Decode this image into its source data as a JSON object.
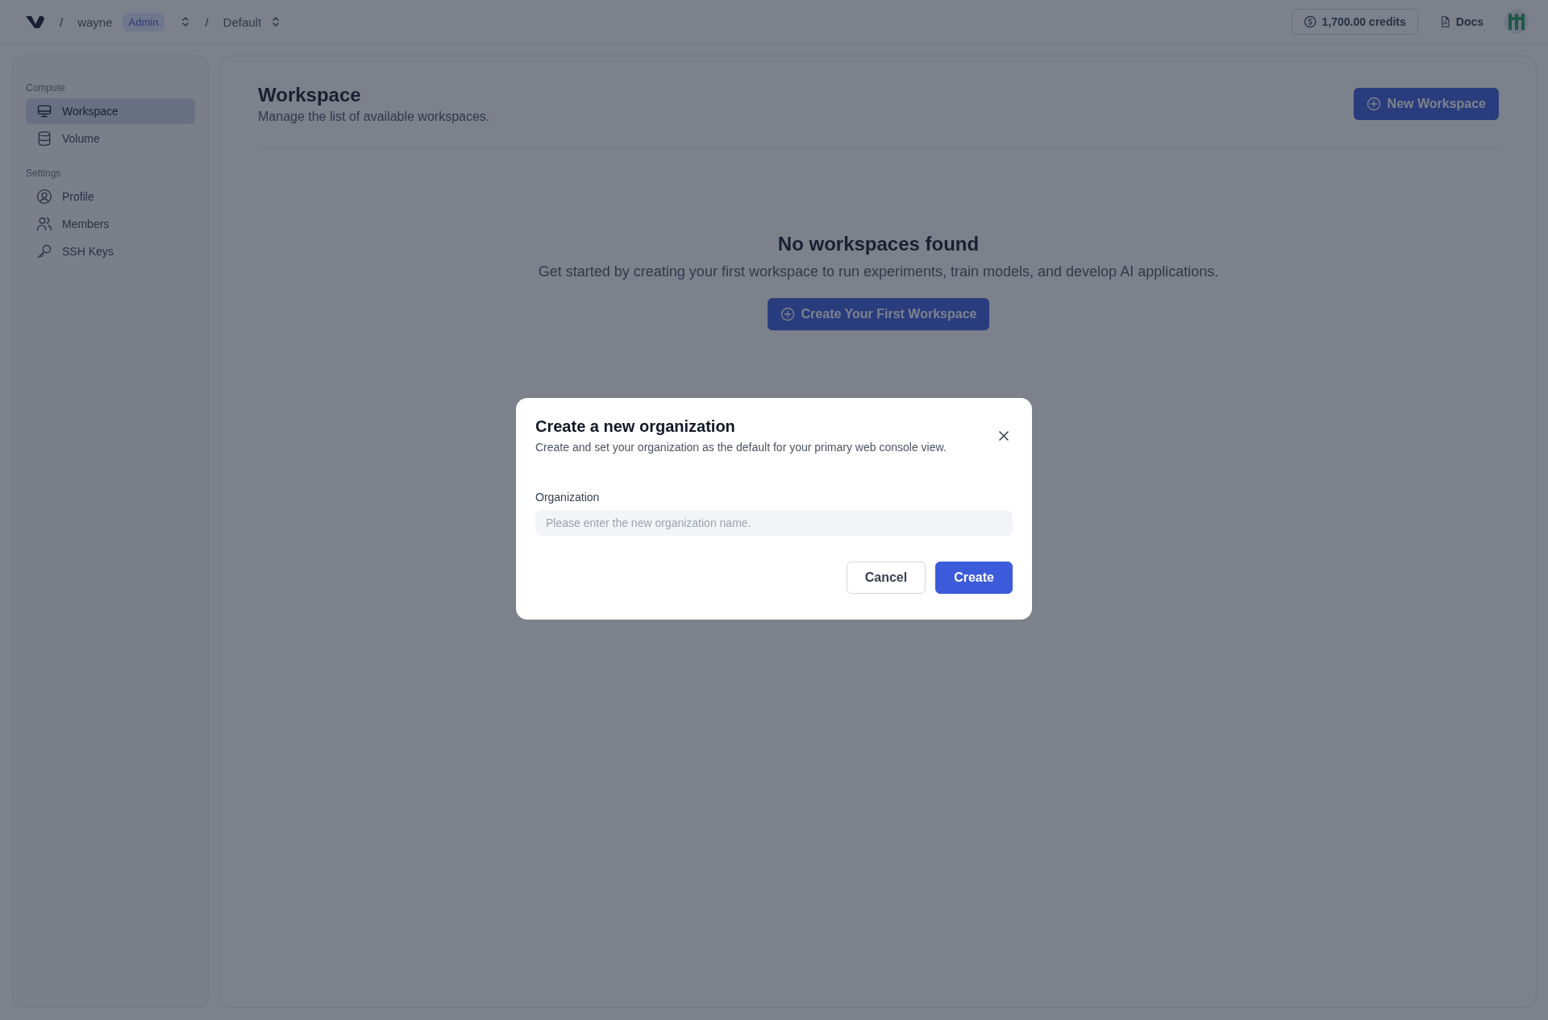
{
  "topbar": {
    "breadcrumbs": [
      {
        "separator": "/",
        "text": "wayne",
        "badge": "Admin"
      },
      {
        "separator": "/",
        "text": "Default"
      }
    ],
    "credits": "1,700.00 credits",
    "docs": "Docs"
  },
  "sidebar": {
    "sections": [
      {
        "title": "Compute",
        "items": [
          {
            "label": "Workspace",
            "selected": true
          },
          {
            "label": "Volume",
            "selected": false
          }
        ]
      },
      {
        "title": "Settings",
        "items": [
          {
            "label": "Profile",
            "selected": false
          },
          {
            "label": "Members",
            "selected": false
          },
          {
            "label": "SSH Keys",
            "selected": false
          }
        ]
      }
    ]
  },
  "page": {
    "title": "Workspace",
    "subtitle": "Manage the list of available workspaces.",
    "new_button": "New Workspace",
    "empty": {
      "title": "No workspaces found",
      "text": "Get started by creating your first workspace to run experiments, train models, and develop AI applications.",
      "button": "Create Your First Workspace"
    }
  },
  "dialog": {
    "title": "Create a new organization",
    "description": "Create and set your organization as the default for your primary web console view.",
    "field_label": "Organization",
    "placeholder": "Please enter the new organization name.",
    "buttons": [
      {
        "label": "Cancel",
        "kind": "secondary"
      },
      {
        "label": "Create",
        "kind": "primary"
      }
    ]
  }
}
